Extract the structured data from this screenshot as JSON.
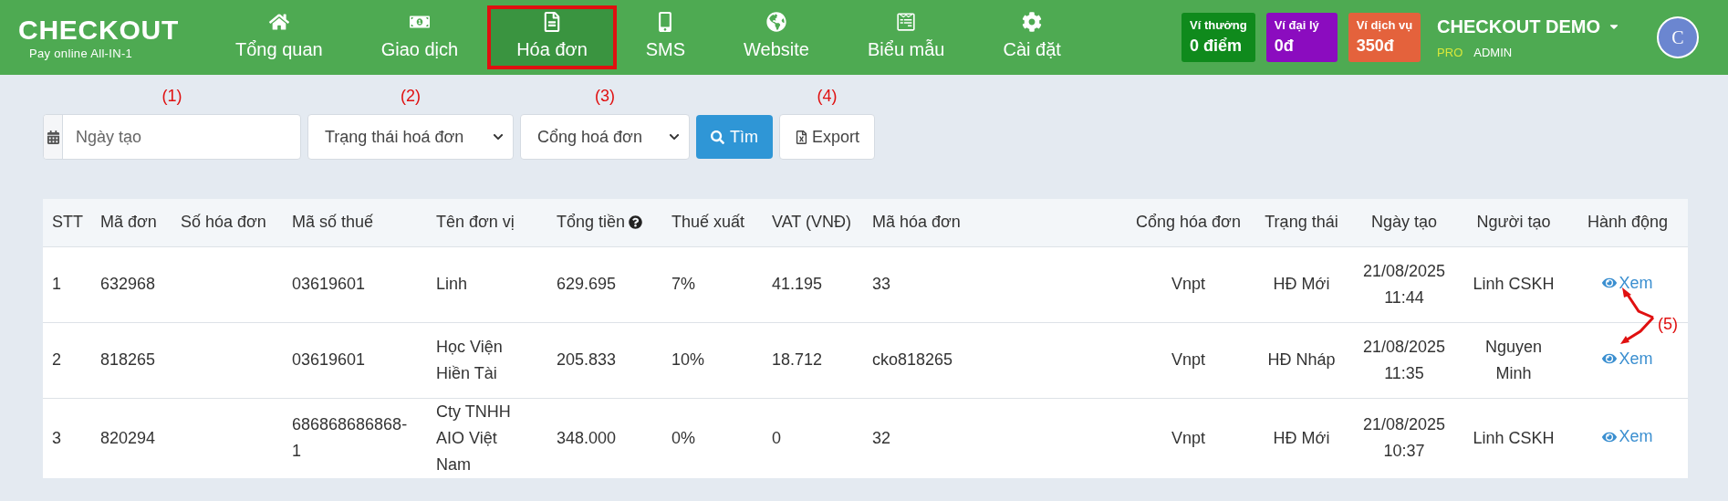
{
  "brand": {
    "title": "CHECKOUT",
    "tagline": "Pay online All-IN-1"
  },
  "nav": {
    "items": [
      {
        "label": "Tổng quan",
        "selected": false
      },
      {
        "label": "Giao dịch",
        "selected": false
      },
      {
        "label": "Hóa đơn",
        "selected": true
      },
      {
        "label": "SMS",
        "selected": false
      },
      {
        "label": "Website",
        "selected": false
      },
      {
        "label": "Biểu mẫu",
        "selected": false
      },
      {
        "label": "Cài đặt",
        "selected": false
      }
    ]
  },
  "wallets": [
    {
      "label": "Ví thưởng",
      "value": "0 điểm",
      "color": "#0f8a1c"
    },
    {
      "label": "Ví đại lý",
      "value": "0đ",
      "color": "#8b0cbf"
    },
    {
      "label": "Ví dịch vụ",
      "value": "350đ",
      "color": "#e4623c"
    }
  ],
  "user": {
    "name": "CHECKOUT DEMO",
    "plan": "PRO",
    "role": "ADMIN",
    "avatar": "C"
  },
  "filters": {
    "date": {
      "placeholder": "Ngày tạo",
      "marker": "(1)"
    },
    "status": {
      "value": "Trạng thái hoá đơn",
      "marker": "(2)"
    },
    "gateway": {
      "value": "Cổng hoá đơn",
      "marker": "(3)"
    },
    "search_button": "Tìm",
    "export_button": {
      "label": "Export",
      "marker": "(4)"
    }
  },
  "table": {
    "columns": [
      "STT",
      "Mã đơn",
      "Số hóa đơn",
      "Mã số thuế",
      "Tên đơn vị",
      "Tổng tiền",
      "Thuế xuất",
      "VAT (VNĐ)",
      "Mã hóa đơn",
      "Cổng hóa đơn",
      "Trạng thái",
      "Ngày tạo",
      "Người tạo",
      "Hành động"
    ],
    "action_marker": "(5)",
    "rows": [
      {
        "cells": [
          "1",
          "632968",
          "",
          "03619601",
          "Linh",
          "629.695",
          "7%",
          "41.195",
          "33",
          "Vnpt",
          "HĐ Mới",
          "21/08/2025 11:44",
          "Linh CSKH"
        ],
        "action": "Xem"
      },
      {
        "cells": [
          "2",
          "818265",
          "",
          "03619601",
          "Học Viện Hiền Tài",
          "205.833",
          "10%",
          "18.712",
          "cko818265",
          "Vnpt",
          "HĐ Nháp",
          "21/08/2025 11:35",
          "Nguyen Minh"
        ],
        "action": "Xem"
      },
      {
        "cells": [
          "3",
          "820294",
          "",
          "686868686868-1",
          "Cty TNHH AIO Việt Nam",
          "348.000",
          "0%",
          "0",
          "32",
          "Vnpt",
          "HĐ Mới",
          "21/08/2025 10:37",
          "Linh CSKH"
        ],
        "action": "Xem"
      }
    ]
  }
}
